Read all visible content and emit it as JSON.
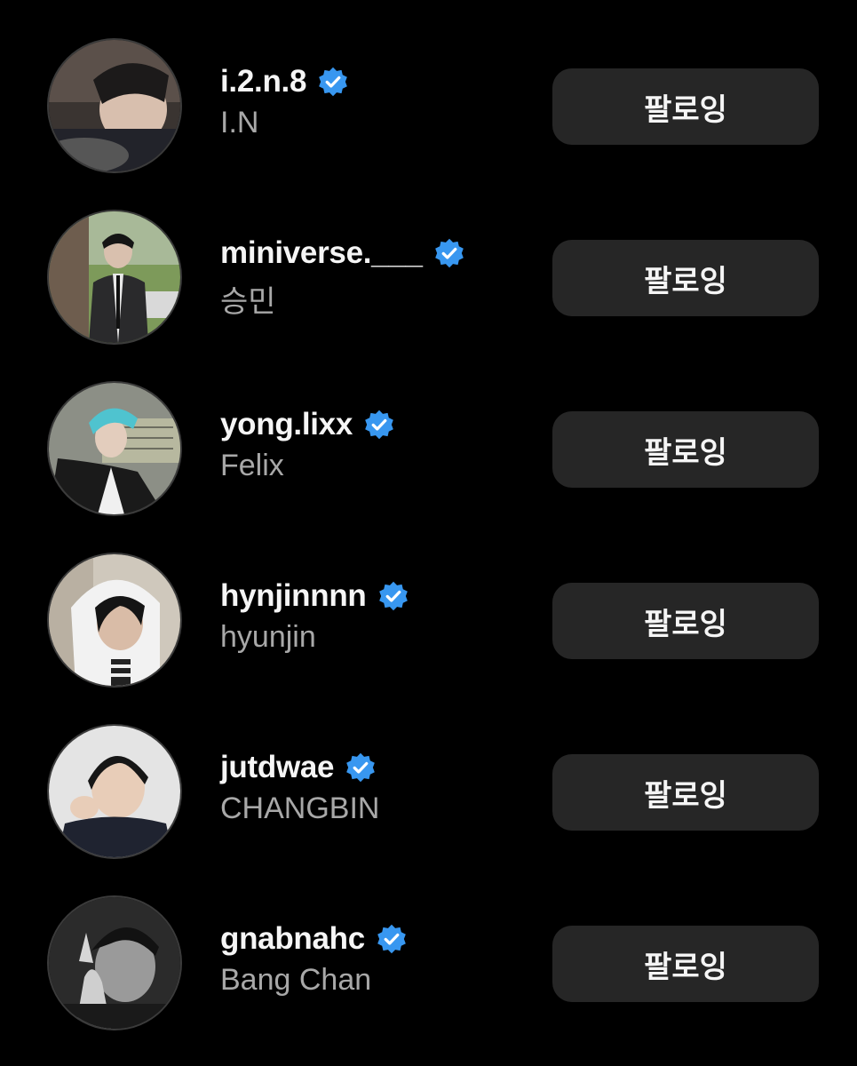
{
  "following_list": {
    "accent_color": "#3897f0",
    "button_color": "#262626",
    "verified_icon": "verified-badge-icon",
    "items": [
      {
        "username": "i.2.n.8",
        "full_name": "I.N",
        "button_label": "팔로잉"
      },
      {
        "username": "miniverse.___",
        "full_name": "승민",
        "button_label": "팔로잉"
      },
      {
        "username": "yong.lixx",
        "full_name": "Felix",
        "button_label": "팔로잉"
      },
      {
        "username": "hynjinnnn",
        "full_name": "hyunjin",
        "button_label": "팔로잉"
      },
      {
        "username": "jutdwae",
        "full_name": "CHANGBIN",
        "button_label": "팔로잉"
      },
      {
        "username": "gnabnahc",
        "full_name": "Bang Chan",
        "button_label": "팔로잉"
      }
    ]
  }
}
